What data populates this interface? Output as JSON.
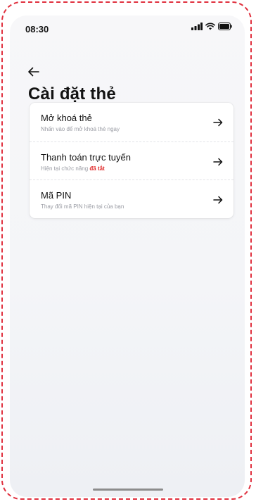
{
  "status_bar": {
    "time": "08:30"
  },
  "page": {
    "title": "Cài đặt thẻ"
  },
  "items": [
    {
      "title": "Mở khoá thẻ",
      "subtitle": "Nhấn vào để mở khoá thẻ ngay"
    },
    {
      "title": "Thanh toán trực tuyến",
      "subtitle_prefix": "Hiện tại chức năng",
      "status": "đã tắt",
      "status_color": "#e02424"
    },
    {
      "title": "Mã PIN",
      "subtitle": "Thay đổi mã PIN hiện tại của bạn"
    }
  ],
  "icons": {
    "back": "arrow-left-icon",
    "row_arrow": "arrow-right-icon",
    "signal": "signal-icon",
    "wifi": "wifi-icon",
    "battery": "battery-icon"
  },
  "colors": {
    "accent": "#e02424",
    "frame": "#e0303e"
  }
}
